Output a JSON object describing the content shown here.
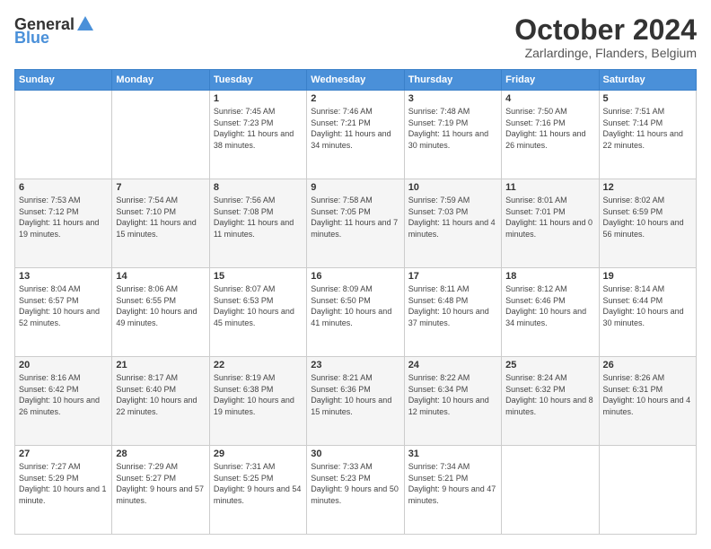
{
  "header": {
    "logo_general": "General",
    "logo_blue": "Blue",
    "title": "October 2024",
    "location": "Zarlardinge, Flanders, Belgium"
  },
  "weekdays": [
    "Sunday",
    "Monday",
    "Tuesday",
    "Wednesday",
    "Thursday",
    "Friday",
    "Saturday"
  ],
  "weeks": [
    [
      {
        "day": "",
        "sunrise": "",
        "sunset": "",
        "daylight": ""
      },
      {
        "day": "",
        "sunrise": "",
        "sunset": "",
        "daylight": ""
      },
      {
        "day": "1",
        "sunrise": "Sunrise: 7:45 AM",
        "sunset": "Sunset: 7:23 PM",
        "daylight": "Daylight: 11 hours and 38 minutes."
      },
      {
        "day": "2",
        "sunrise": "Sunrise: 7:46 AM",
        "sunset": "Sunset: 7:21 PM",
        "daylight": "Daylight: 11 hours and 34 minutes."
      },
      {
        "day": "3",
        "sunrise": "Sunrise: 7:48 AM",
        "sunset": "Sunset: 7:19 PM",
        "daylight": "Daylight: 11 hours and 30 minutes."
      },
      {
        "day": "4",
        "sunrise": "Sunrise: 7:50 AM",
        "sunset": "Sunset: 7:16 PM",
        "daylight": "Daylight: 11 hours and 26 minutes."
      },
      {
        "day": "5",
        "sunrise": "Sunrise: 7:51 AM",
        "sunset": "Sunset: 7:14 PM",
        "daylight": "Daylight: 11 hours and 22 minutes."
      }
    ],
    [
      {
        "day": "6",
        "sunrise": "Sunrise: 7:53 AM",
        "sunset": "Sunset: 7:12 PM",
        "daylight": "Daylight: 11 hours and 19 minutes."
      },
      {
        "day": "7",
        "sunrise": "Sunrise: 7:54 AM",
        "sunset": "Sunset: 7:10 PM",
        "daylight": "Daylight: 11 hours and 15 minutes."
      },
      {
        "day": "8",
        "sunrise": "Sunrise: 7:56 AM",
        "sunset": "Sunset: 7:08 PM",
        "daylight": "Daylight: 11 hours and 11 minutes."
      },
      {
        "day": "9",
        "sunrise": "Sunrise: 7:58 AM",
        "sunset": "Sunset: 7:05 PM",
        "daylight": "Daylight: 11 hours and 7 minutes."
      },
      {
        "day": "10",
        "sunrise": "Sunrise: 7:59 AM",
        "sunset": "Sunset: 7:03 PM",
        "daylight": "Daylight: 11 hours and 4 minutes."
      },
      {
        "day": "11",
        "sunrise": "Sunrise: 8:01 AM",
        "sunset": "Sunset: 7:01 PM",
        "daylight": "Daylight: 11 hours and 0 minutes."
      },
      {
        "day": "12",
        "sunrise": "Sunrise: 8:02 AM",
        "sunset": "Sunset: 6:59 PM",
        "daylight": "Daylight: 10 hours and 56 minutes."
      }
    ],
    [
      {
        "day": "13",
        "sunrise": "Sunrise: 8:04 AM",
        "sunset": "Sunset: 6:57 PM",
        "daylight": "Daylight: 10 hours and 52 minutes."
      },
      {
        "day": "14",
        "sunrise": "Sunrise: 8:06 AM",
        "sunset": "Sunset: 6:55 PM",
        "daylight": "Daylight: 10 hours and 49 minutes."
      },
      {
        "day": "15",
        "sunrise": "Sunrise: 8:07 AM",
        "sunset": "Sunset: 6:53 PM",
        "daylight": "Daylight: 10 hours and 45 minutes."
      },
      {
        "day": "16",
        "sunrise": "Sunrise: 8:09 AM",
        "sunset": "Sunset: 6:50 PM",
        "daylight": "Daylight: 10 hours and 41 minutes."
      },
      {
        "day": "17",
        "sunrise": "Sunrise: 8:11 AM",
        "sunset": "Sunset: 6:48 PM",
        "daylight": "Daylight: 10 hours and 37 minutes."
      },
      {
        "day": "18",
        "sunrise": "Sunrise: 8:12 AM",
        "sunset": "Sunset: 6:46 PM",
        "daylight": "Daylight: 10 hours and 34 minutes."
      },
      {
        "day": "19",
        "sunrise": "Sunrise: 8:14 AM",
        "sunset": "Sunset: 6:44 PM",
        "daylight": "Daylight: 10 hours and 30 minutes."
      }
    ],
    [
      {
        "day": "20",
        "sunrise": "Sunrise: 8:16 AM",
        "sunset": "Sunset: 6:42 PM",
        "daylight": "Daylight: 10 hours and 26 minutes."
      },
      {
        "day": "21",
        "sunrise": "Sunrise: 8:17 AM",
        "sunset": "Sunset: 6:40 PM",
        "daylight": "Daylight: 10 hours and 22 minutes."
      },
      {
        "day": "22",
        "sunrise": "Sunrise: 8:19 AM",
        "sunset": "Sunset: 6:38 PM",
        "daylight": "Daylight: 10 hours and 19 minutes."
      },
      {
        "day": "23",
        "sunrise": "Sunrise: 8:21 AM",
        "sunset": "Sunset: 6:36 PM",
        "daylight": "Daylight: 10 hours and 15 minutes."
      },
      {
        "day": "24",
        "sunrise": "Sunrise: 8:22 AM",
        "sunset": "Sunset: 6:34 PM",
        "daylight": "Daylight: 10 hours and 12 minutes."
      },
      {
        "day": "25",
        "sunrise": "Sunrise: 8:24 AM",
        "sunset": "Sunset: 6:32 PM",
        "daylight": "Daylight: 10 hours and 8 minutes."
      },
      {
        "day": "26",
        "sunrise": "Sunrise: 8:26 AM",
        "sunset": "Sunset: 6:31 PM",
        "daylight": "Daylight: 10 hours and 4 minutes."
      }
    ],
    [
      {
        "day": "27",
        "sunrise": "Sunrise: 7:27 AM",
        "sunset": "Sunset: 5:29 PM",
        "daylight": "Daylight: 10 hours and 1 minute."
      },
      {
        "day": "28",
        "sunrise": "Sunrise: 7:29 AM",
        "sunset": "Sunset: 5:27 PM",
        "daylight": "Daylight: 9 hours and 57 minutes."
      },
      {
        "day": "29",
        "sunrise": "Sunrise: 7:31 AM",
        "sunset": "Sunset: 5:25 PM",
        "daylight": "Daylight: 9 hours and 54 minutes."
      },
      {
        "day": "30",
        "sunrise": "Sunrise: 7:33 AM",
        "sunset": "Sunset: 5:23 PM",
        "daylight": "Daylight: 9 hours and 50 minutes."
      },
      {
        "day": "31",
        "sunrise": "Sunrise: 7:34 AM",
        "sunset": "Sunset: 5:21 PM",
        "daylight": "Daylight: 9 hours and 47 minutes."
      },
      {
        "day": "",
        "sunrise": "",
        "sunset": "",
        "daylight": ""
      },
      {
        "day": "",
        "sunrise": "",
        "sunset": "",
        "daylight": ""
      }
    ]
  ]
}
